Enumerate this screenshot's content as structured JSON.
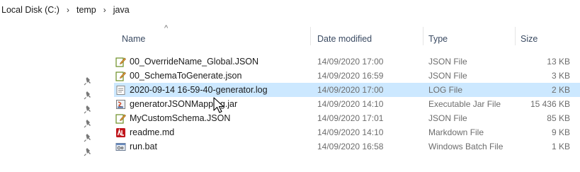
{
  "breadcrumb": [
    "Local Disk (C:)",
    "temp",
    "java"
  ],
  "columns": {
    "name": "Name",
    "date": "Date modified",
    "type": "Type",
    "size": "Size"
  },
  "files": [
    {
      "name": "00_OverrideName_Global.JSON",
      "date": "14/09/2020 17:00",
      "type": "JSON File",
      "size": "13 KB",
      "icon": "json-file-icon",
      "pinned": false
    },
    {
      "name": "00_SchemaToGenerate.json",
      "date": "14/09/2020 16:59",
      "type": "JSON File",
      "size": "3 KB",
      "icon": "json-file-icon",
      "pinned": true
    },
    {
      "name": "2020-09-14 16-59-40-generator.log",
      "date": "14/09/2020 17:00",
      "type": "LOG File",
      "size": "2 KB",
      "icon": "log-file-icon",
      "pinned": true,
      "selected": true
    },
    {
      "name": "generatorJSONMapping.jar",
      "date": "14/09/2020 14:10",
      "type": "Executable Jar File",
      "size": "15 436 KB",
      "icon": "jar-file-icon",
      "pinned": true
    },
    {
      "name": "MyCustomSchema.JSON",
      "date": "14/09/2020 17:01",
      "type": "JSON File",
      "size": "85 KB",
      "icon": "json-file-icon",
      "pinned": true
    },
    {
      "name": "readme.md",
      "date": "14/09/2020 14:10",
      "type": "Markdown File",
      "size": "9 KB",
      "icon": "markdown-file-icon",
      "pinned": true
    },
    {
      "name": "run.bat",
      "date": "14/09/2020 16:58",
      "type": "Windows Batch File",
      "size": "1 KB",
      "icon": "batch-file-icon",
      "pinned": true
    }
  ],
  "colors": {
    "selection": "#cce8ff",
    "header_text": "#3a4a62",
    "secondary_text": "#6d6d6d"
  }
}
